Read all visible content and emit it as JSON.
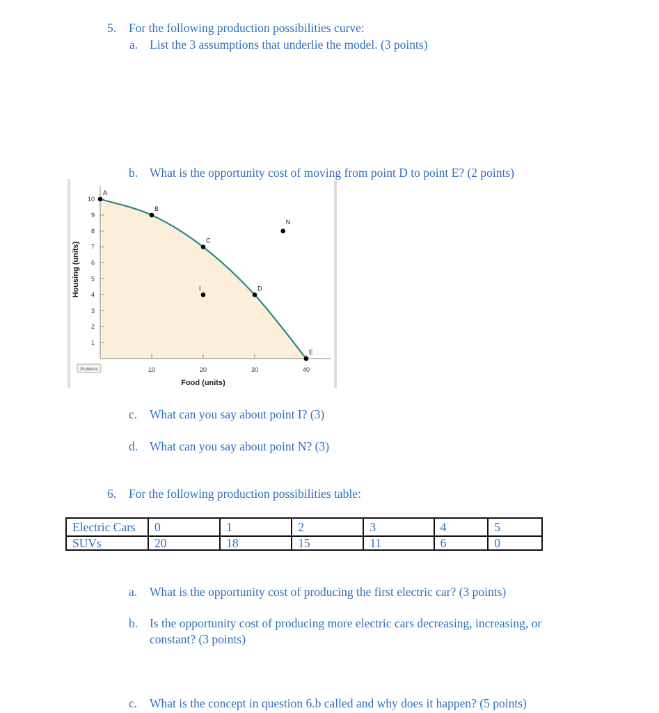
{
  "q5": {
    "num": "5.",
    "text": "For the following production possibilities curve:",
    "a_label": "a.",
    "a": "List the 3 assumptions that underlie the model. (3 points)",
    "b_label": "b.",
    "b": "What is the opportunity cost of moving from point D to point E? (2 points)",
    "c_label": "c.",
    "c": "What can you say about point I? (3)",
    "d_label": "d.",
    "d": "What can you say about point N? (3)"
  },
  "chart_data": {
    "type": "line",
    "xlabel": "Food (units)",
    "ylabel": "Housing (units)",
    "xlim": [
      0,
      42
    ],
    "ylim": [
      0,
      10.5
    ],
    "xticks": [
      10,
      20,
      30,
      40
    ],
    "yticks": [
      1,
      2,
      3,
      4,
      5,
      6,
      7,
      8,
      9,
      10
    ],
    "curve": [
      {
        "label": "A",
        "x": 0,
        "y": 10
      },
      {
        "label": "B",
        "x": 10,
        "y": 9
      },
      {
        "label": "C",
        "x": 20,
        "y": 7
      },
      {
        "label": "D",
        "x": 30,
        "y": 4
      },
      {
        "label": "E",
        "x": 40,
        "y": 0
      }
    ],
    "points": [
      {
        "label": "I",
        "x": 20,
        "y": 4
      },
      {
        "label": "N",
        "x": 35.5,
        "y": 8
      }
    ],
    "curve_color": "#2a8a80",
    "fill_color": "#fcefd9",
    "button": "Problems"
  },
  "q6": {
    "num": "6.",
    "text": "For the following production possibilities table:",
    "table": {
      "rows": [
        {
          "label": "Electric Cars",
          "values": [
            "0",
            "1",
            "2",
            "3",
            "4",
            "5"
          ]
        },
        {
          "label": "SUVs",
          "values": [
            "20",
            "18",
            "15",
            "11",
            "6",
            "0"
          ]
        }
      ]
    },
    "a_label": "a.",
    "a": "What is the opportunity cost of producing the first electric car? (3 points)",
    "b_label": "b.",
    "b": "Is the opportunity cost of producing more electric cars decreasing, increasing, or",
    "b2": "constant?  (3 points)",
    "c_label": "c.",
    "c": "What is the concept in question 6.b called and why does it happen? (5 points)"
  }
}
